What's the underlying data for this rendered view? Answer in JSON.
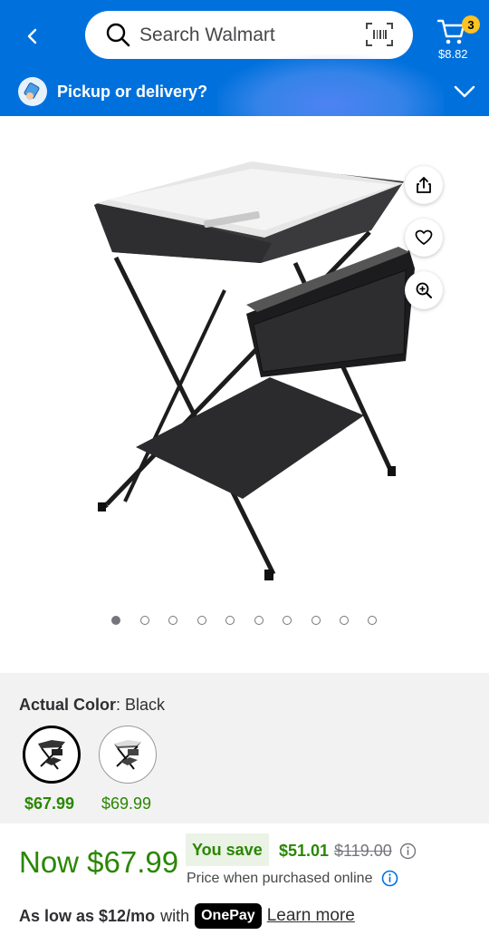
{
  "header": {
    "search_placeholder": "Search Walmart",
    "cart_count": "3",
    "cart_total": "$8.82",
    "pickup_text": "Pickup or delivery?",
    "brand_color": "#0071dc",
    "badge_color": "#ffc220"
  },
  "gallery": {
    "image_count": 10,
    "active_index": 0,
    "icons": [
      "share-icon",
      "heart-icon",
      "zoom-in-icon"
    ]
  },
  "variant": {
    "label": "Actual Color",
    "value": ": Black",
    "options": [
      {
        "price": "$67.99",
        "selected": true
      },
      {
        "price": "$69.99",
        "selected": false
      }
    ]
  },
  "pricing": {
    "now_price": "Now $67.99",
    "you_save_label": "You save",
    "save_amount": "$51.01",
    "was_price": "$119.00",
    "online_note": "Price when purchased online",
    "price_color": "#2a8703"
  },
  "finance": {
    "prefix": "As low as $12/mo",
    "with": "with",
    "onepay_label": "OnePay",
    "learn_more": "Learn more"
  }
}
